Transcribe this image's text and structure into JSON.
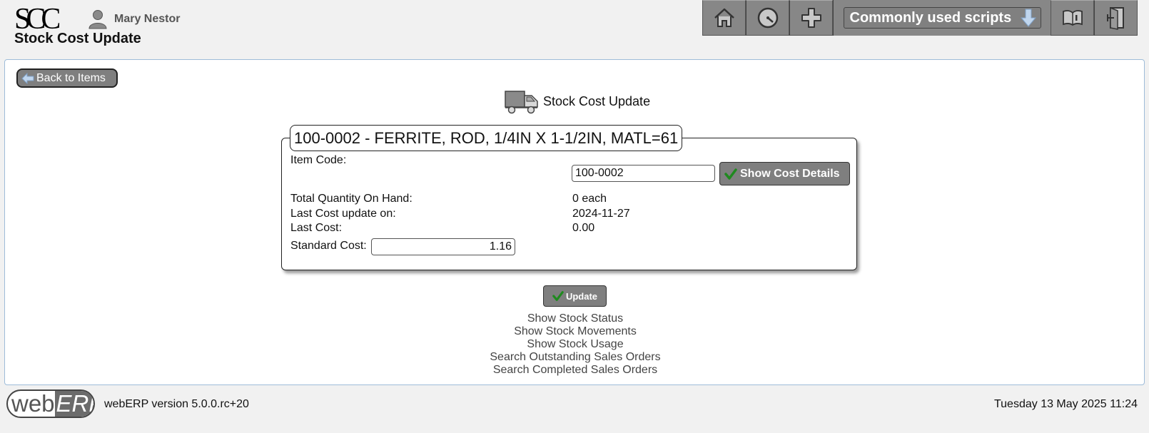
{
  "header": {
    "logo_text": "SCC",
    "user_name": "Mary Nestor",
    "page_title": "Stock Cost Update",
    "toolbar": {
      "icons": [
        "home-icon",
        "dashboard-icon",
        "plus-icon",
        "manual-icon",
        "logout-icon"
      ],
      "scripts_label": "Commonly used scripts"
    }
  },
  "main": {
    "back_label": "Back to Items",
    "heading": "Stock Cost Update",
    "legend": "100-0002 - FERRITE, ROD, 1/4IN X 1-1/2IN, MATL=61",
    "fields": {
      "item_code_label": "Item Code:",
      "item_code_value": "100-0002",
      "show_cost_label": "Show Cost Details",
      "qty_label": "Total Quantity On Hand:",
      "qty_value": "0 each",
      "last_update_label": "Last Cost update on:",
      "last_update_value": "2024-11-27",
      "last_cost_label": "Last Cost:",
      "last_cost_value": "0.00",
      "standard_cost_label": "Standard Cost:",
      "standard_cost_value": "1.16"
    },
    "update_label": "Update",
    "links": [
      "Show Stock Status",
      "Show Stock Movements",
      "Show Stock Usage",
      "Search Outstanding Sales Orders",
      "Search Completed Sales Orders"
    ]
  },
  "footer": {
    "logo_web": "web",
    "logo_erp": "ERP",
    "version": "webERP version 5.0.0.rc+20",
    "datetime": "Tuesday 13 May 2025 11:24"
  },
  "colors": {
    "button_gray": "#7f7f7f",
    "toolbar_gray": "#878787",
    "check_green": "#1f8a1f",
    "panel_border": "#9ebcd9"
  }
}
